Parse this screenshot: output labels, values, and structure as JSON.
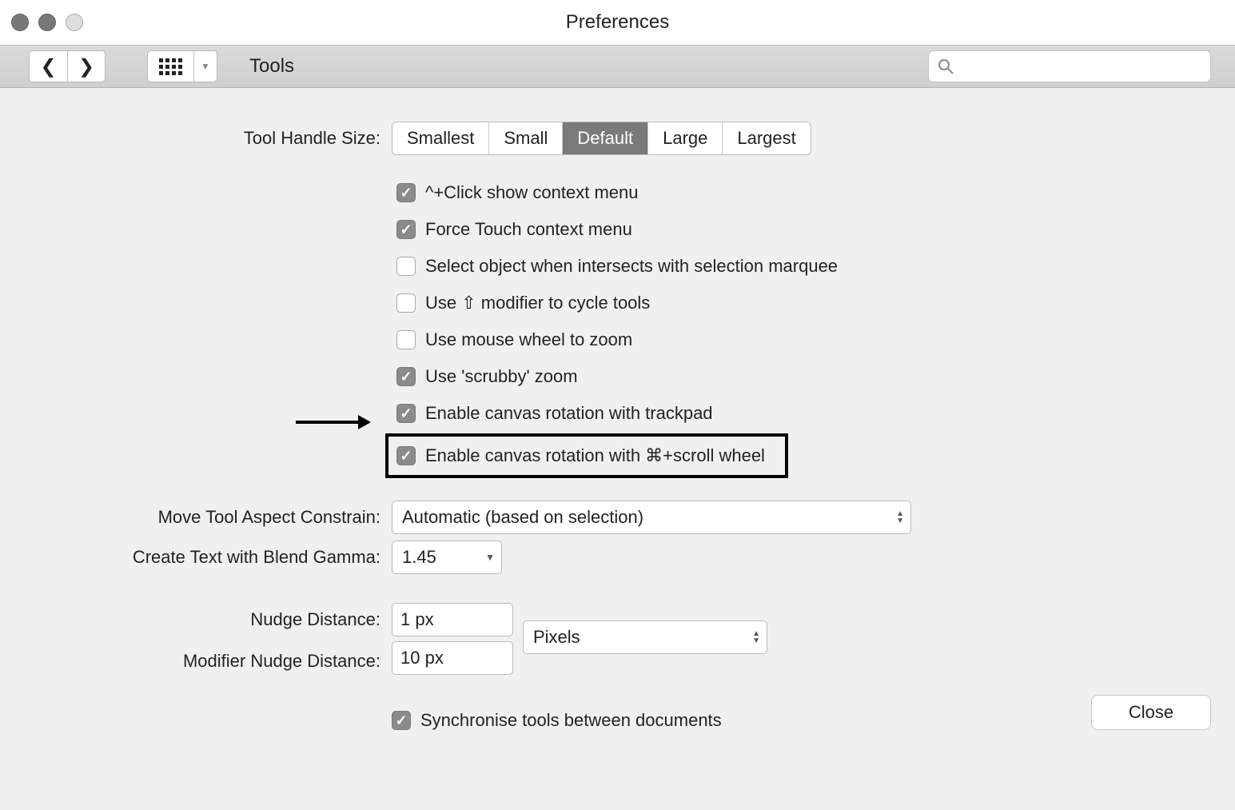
{
  "window": {
    "title": "Preferences"
  },
  "toolbar": {
    "section": "Tools",
    "search_placeholder": ""
  },
  "tool_handle": {
    "label": "Tool Handle Size:",
    "options": [
      "Smallest",
      "Small",
      "Default",
      "Large",
      "Largest"
    ],
    "selected": "Default"
  },
  "checks": {
    "ctrl_click_context": {
      "label": "^+Click show context menu",
      "checked": true
    },
    "force_touch_context": {
      "label": "Force Touch context menu",
      "checked": true
    },
    "select_intersect": {
      "label": "Select object when intersects with selection marquee",
      "checked": false
    },
    "shift_cycle": {
      "label": "Use ⇧ modifier to cycle tools",
      "checked": false
    },
    "wheel_zoom": {
      "label": "Use mouse wheel to zoom",
      "checked": false
    },
    "scrubby_zoom": {
      "label": "Use 'scrubby' zoom",
      "checked": true
    },
    "canvas_rot_trackpad": {
      "label": "Enable canvas rotation with trackpad",
      "checked": true
    },
    "canvas_rot_scroll": {
      "label": "Enable canvas rotation with ⌘+scroll wheel",
      "checked": true
    }
  },
  "move_aspect": {
    "label": "Move Tool Aspect Constrain:",
    "value": "Automatic (based on selection)"
  },
  "blend_gamma": {
    "label": "Create Text with Blend Gamma:",
    "value": "1.45"
  },
  "nudge": {
    "label": "Nudge Distance:",
    "value": "1 px"
  },
  "mod_nudge": {
    "label": "Modifier Nudge Distance:",
    "value": "10 px"
  },
  "nudge_units": {
    "value": "Pixels"
  },
  "sync_tools": {
    "label": "Synchronise tools between documents",
    "checked": true
  },
  "close_label": "Close"
}
